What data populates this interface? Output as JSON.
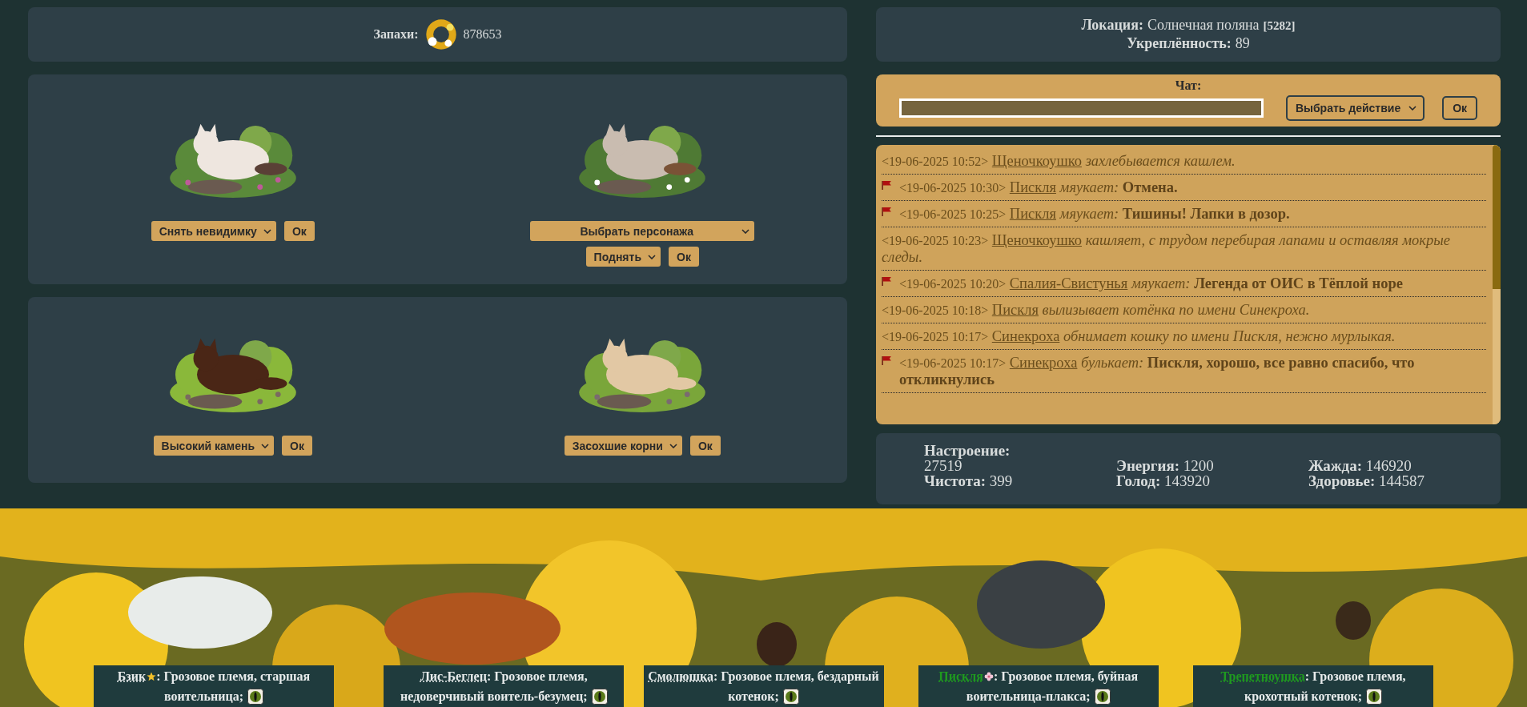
{
  "scents": {
    "label": "Запахи:",
    "value": "878653"
  },
  "location": {
    "label": "Локация:",
    "name": "Солнечная поляна",
    "code": "[5282]",
    "fortification_label": "Укреплённость:",
    "fortification": "89"
  },
  "spots": [
    {
      "controls": [
        {
          "kind": "select",
          "text": "Снять невидимку"
        },
        {
          "kind": "button",
          "text": "Ок"
        }
      ]
    },
    {
      "controls": [
        {
          "kind": "select_wide",
          "text": "Выбрать персонажа"
        },
        {
          "kind": "select",
          "text": "Поднять"
        },
        {
          "kind": "button",
          "text": "Ок"
        }
      ]
    },
    {
      "controls": [
        {
          "kind": "select",
          "text": "Высокий камень"
        },
        {
          "kind": "button",
          "text": "Ок"
        }
      ]
    },
    {
      "controls": [
        {
          "kind": "select",
          "text": "Засохшие корни"
        },
        {
          "kind": "button",
          "text": "Ок"
        }
      ]
    }
  ],
  "chat": {
    "label": "Чат:",
    "action_select": "Выбрать действие",
    "send_button": "Ок"
  },
  "messages": [
    {
      "flagged": false,
      "time": "<19-06-2025 10:52>",
      "name": "Щеночкоушко",
      "action": "захлебывается кашлем."
    },
    {
      "flagged": true,
      "time": "<19-06-2025 10:30>",
      "name": "Пискля",
      "action": "мяукает:",
      "speech": "Отмена."
    },
    {
      "flagged": true,
      "time": "<19-06-2025 10:25>",
      "name": "Пискля",
      "action": "мяукает:",
      "speech": "Тишины! Лапки в дозор."
    },
    {
      "flagged": false,
      "time": "<19-06-2025 10:23>",
      "name": "Щеночкоушко",
      "action": "кашляет, с трудом перебирая лапами и оставляя мокрые следы."
    },
    {
      "flagged": true,
      "time": "<19-06-2025 10:20>",
      "name": "Спалия-Свистунья",
      "action": "мяукает:",
      "speech": "Легенда от ОИС в Тёплой норе"
    },
    {
      "flagged": false,
      "time": "<19-06-2025 10:18>",
      "name": "Пискля",
      "action": "вылизывает котёнка по имени Синекроха."
    },
    {
      "flagged": false,
      "time": "<19-06-2025 10:17>",
      "name": "Синекроха",
      "action": "обнимает кошку по имени Пискля, нежно мурлыкая."
    },
    {
      "flagged": true,
      "time": "<19-06-2025 10:17>",
      "name": "Синекроха",
      "action": "булькает:",
      "speech": "Пискля, хорошо, все равно спасибо, что откликнулись"
    }
  ],
  "stats": [
    [
      {
        "label": "Настроение:",
        "value": "27519"
      },
      {
        "label": "Чистота:",
        "value": "399"
      }
    ],
    [
      {
        "label": "Энергия:",
        "value": "1200"
      },
      {
        "label": "Голод:",
        "value": "143920"
      }
    ],
    [
      {
        "label": "Жажда:",
        "value": "146920"
      },
      {
        "label": "Здоровье:",
        "value": "144587"
      }
    ]
  ],
  "characters": [
    {
      "name": "Бзик",
      "highlighted": false,
      "kind": "star",
      "description": ": Грозовое племя, старшая воительница;"
    },
    {
      "name": "Лис-Беглец",
      "highlighted": false,
      "kind": "plain",
      "description": ": Грозовое племя, недоверчивый воитель-безумец;"
    },
    {
      "name": "Смолюшка",
      "highlighted": false,
      "kind": "plain",
      "description": ": Грозовое племя, бездарный котенок;"
    },
    {
      "name": "Пискля",
      "highlighted": true,
      "kind": "flower",
      "description": ": Грозовое племя, буйная воительница-плакса;"
    },
    {
      "name": "Трепетноушка",
      "highlighted": true,
      "kind": "plain",
      "description": ": Грозовое племя, крохотный котенок;"
    }
  ]
}
